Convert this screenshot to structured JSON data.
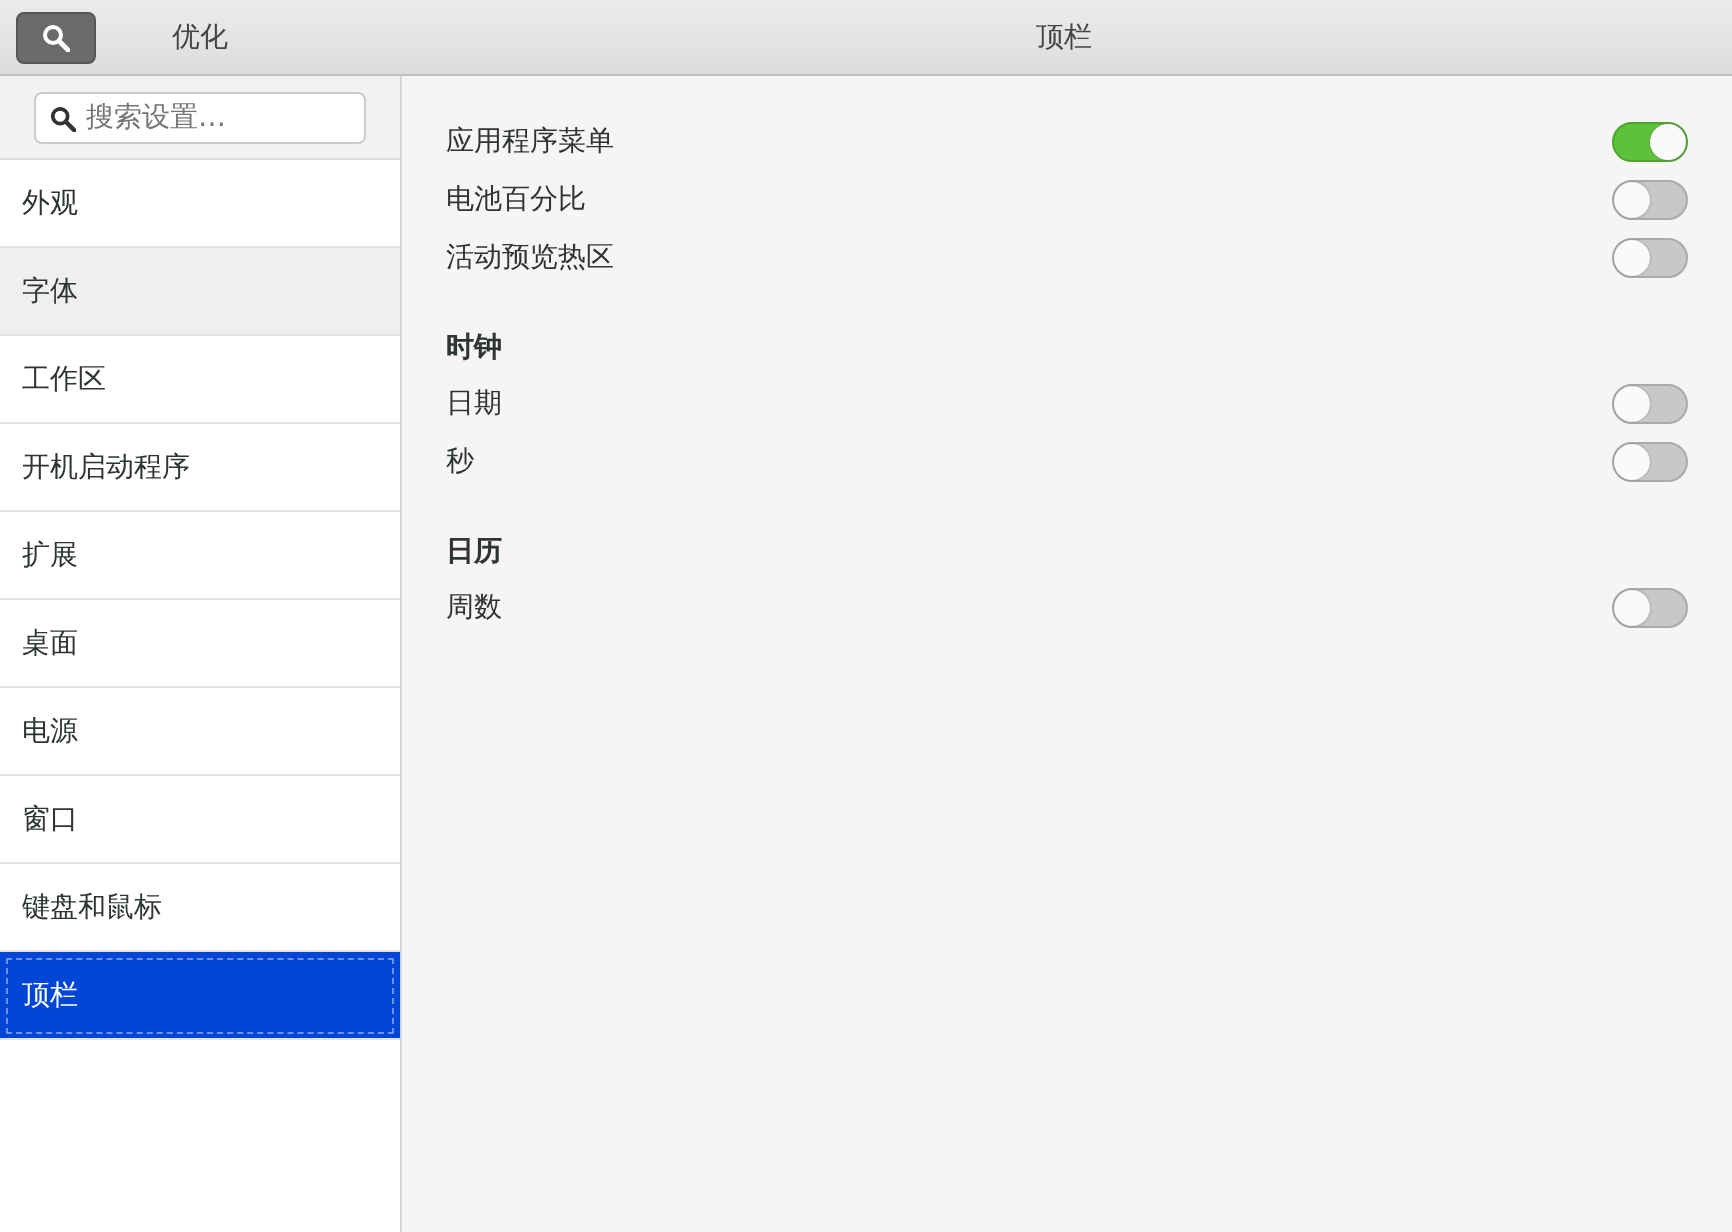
{
  "header": {
    "app_title": "优化",
    "page_title": "顶栏"
  },
  "sidebar": {
    "search": {
      "placeholder": "搜索设置…"
    },
    "items": [
      {
        "label": "外观",
        "selected": false,
        "hovered": false
      },
      {
        "label": "字体",
        "selected": false,
        "hovered": true
      },
      {
        "label": "工作区",
        "selected": false,
        "hovered": false
      },
      {
        "label": "开机启动程序",
        "selected": false,
        "hovered": false
      },
      {
        "label": "扩展",
        "selected": false,
        "hovered": false
      },
      {
        "label": "桌面",
        "selected": false,
        "hovered": false
      },
      {
        "label": "电源",
        "selected": false,
        "hovered": false
      },
      {
        "label": "窗口",
        "selected": false,
        "hovered": false
      },
      {
        "label": "键盘和鼠标",
        "selected": false,
        "hovered": false
      },
      {
        "label": "顶栏",
        "selected": true,
        "hovered": false
      }
    ]
  },
  "sections": [
    {
      "items": [
        {
          "label": "应用程序菜单",
          "on": true
        },
        {
          "label": "电池百分比",
          "on": false
        },
        {
          "label": "活动预览热区",
          "on": false
        }
      ]
    },
    {
      "title": "时钟",
      "items": [
        {
          "label": "日期",
          "on": false
        },
        {
          "label": "秒",
          "on": false
        }
      ]
    },
    {
      "title": "日历",
      "items": [
        {
          "label": "周数",
          "on": false
        }
      ]
    }
  ]
}
